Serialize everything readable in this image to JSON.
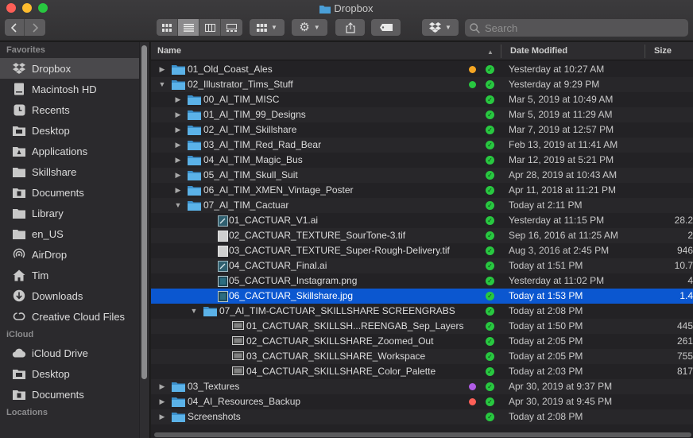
{
  "window": {
    "title": "Dropbox"
  },
  "toolbar": {
    "search_placeholder": "Search"
  },
  "sidebar": {
    "sections": [
      {
        "heading": "Favorites",
        "items": [
          {
            "label": "Dropbox",
            "icon": "dropbox-icon",
            "active": true
          },
          {
            "label": "Macintosh HD",
            "icon": "hard-drive-icon"
          },
          {
            "label": "Recents",
            "icon": "recents-icon"
          },
          {
            "label": "Desktop",
            "icon": "desktop-icon"
          },
          {
            "label": "Applications",
            "icon": "applications-icon"
          },
          {
            "label": "Skillshare",
            "icon": "folder-icon"
          },
          {
            "label": "Documents",
            "icon": "documents-icon"
          },
          {
            "label": "Library",
            "icon": "folder-icon"
          },
          {
            "label": "en_US",
            "icon": "folder-icon"
          },
          {
            "label": "AirDrop",
            "icon": "airdrop-icon"
          },
          {
            "label": "Tim",
            "icon": "home-icon"
          },
          {
            "label": "Downloads",
            "icon": "downloads-icon"
          },
          {
            "label": "Creative Cloud Files",
            "icon": "creative-cloud-icon"
          }
        ]
      },
      {
        "heading": "iCloud",
        "items": [
          {
            "label": "iCloud Drive",
            "icon": "icloud-icon"
          },
          {
            "label": "Desktop",
            "icon": "desktop-icon"
          },
          {
            "label": "Documents",
            "icon": "documents-icon"
          }
        ]
      },
      {
        "heading": "Locations",
        "items": []
      }
    ]
  },
  "columns": {
    "name": "Name",
    "date": "Date Modified",
    "size": "Size"
  },
  "files": [
    {
      "name": "01_Old_Coast_Ales",
      "kind": "folder",
      "depth": 0,
      "disclosure": "closed",
      "tag": "#f5a623",
      "date": "Yesterday at 10:27 AM",
      "size": ""
    },
    {
      "name": "02_Illustrator_Tims_Stuff",
      "kind": "folder",
      "depth": 0,
      "disclosure": "open",
      "tag": "#28c840",
      "date": "Yesterday at 9:29 PM",
      "size": ""
    },
    {
      "name": "00_AI_TIM_MISC",
      "kind": "folder",
      "depth": 1,
      "disclosure": "closed",
      "date": "Mar 5, 2019 at 10:49 AM",
      "size": ""
    },
    {
      "name": "01_AI_TIM_99_Designs",
      "kind": "folder",
      "depth": 1,
      "disclosure": "closed",
      "date": "Mar 5, 2019 at 11:29 AM",
      "size": ""
    },
    {
      "name": "02_AI_TIM_Skillshare",
      "kind": "folder",
      "depth": 1,
      "disclosure": "closed",
      "date": "Mar 7, 2019 at 12:57 PM",
      "size": ""
    },
    {
      "name": "03_AI_TIM_Red_Rad_Bear",
      "kind": "folder",
      "depth": 1,
      "disclosure": "closed",
      "date": "Feb 13, 2019 at 11:41 AM",
      "size": ""
    },
    {
      "name": "04_AI_TIM_Magic_Bus",
      "kind": "folder",
      "depth": 1,
      "disclosure": "closed",
      "date": "Mar 12, 2019 at 5:21 PM",
      "size": ""
    },
    {
      "name": "05_AI_TIM_Skull_Suit",
      "kind": "folder",
      "depth": 1,
      "disclosure": "closed",
      "date": "Apr 28, 2019 at 10:43 AM",
      "size": ""
    },
    {
      "name": "06_AI_TIM_XMEN_Vintage_Poster",
      "kind": "folder",
      "depth": 1,
      "disclosure": "closed",
      "date": "Apr 11, 2018 at 11:21 PM",
      "size": ""
    },
    {
      "name": "07_AI_TIM_Cactuar",
      "kind": "folder",
      "depth": 1,
      "disclosure": "open",
      "date": "Today at 2:11 PM",
      "size": ""
    },
    {
      "name": "01_CACTUAR_V1.ai",
      "kind": "ai",
      "depth": 2,
      "disclosure": "none",
      "date": "Yesterday at 11:15 PM",
      "size": "28.2"
    },
    {
      "name": "02_CACTUAR_TEXTURE_SourTone-3.tif",
      "kind": "tif",
      "depth": 2,
      "disclosure": "none",
      "date": "Sep 16, 2016 at 11:25 AM",
      "size": "2"
    },
    {
      "name": "03_CACTUAR_TEXTURE_Super-Rough-Delivery.tif",
      "kind": "tif",
      "depth": 2,
      "disclosure": "none",
      "date": "Aug 3, 2016 at 2:45 PM",
      "size": "946"
    },
    {
      "name": "04_CACTUAR_Final.ai",
      "kind": "ai",
      "depth": 2,
      "disclosure": "none",
      "date": "Today at 1:51 PM",
      "size": "10.7"
    },
    {
      "name": "05_CACTUAR_Instagram.png",
      "kind": "img",
      "depth": 2,
      "disclosure": "none",
      "date": "Yesterday at 11:02 PM",
      "size": "4"
    },
    {
      "name": "06_CACTUAR_Skillshare.jpg",
      "kind": "img",
      "depth": 2,
      "disclosure": "none",
      "date": "Today at 1:53 PM",
      "size": "1.4",
      "selected": true
    },
    {
      "name": "07_AI_TIM-CACTUAR_SKILLSHARE SCREENGRABS",
      "kind": "folder",
      "depth": 2,
      "disclosure": "open",
      "date": "Today at 2:08 PM",
      "size": ""
    },
    {
      "name": "01_CACTUAR_SKILLSH...REENGAB_Sep_Layers",
      "kind": "shot",
      "depth": 3,
      "disclosure": "none",
      "date": "Today at 1:50 PM",
      "size": "445"
    },
    {
      "name": "02_CACTUAR_SKILLSHARE_Zoomed_Out",
      "kind": "shot",
      "depth": 3,
      "disclosure": "none",
      "date": "Today at 2:05 PM",
      "size": "261"
    },
    {
      "name": "03_CACTUAR_SKILLSHARE_Workspace",
      "kind": "shot",
      "depth": 3,
      "disclosure": "none",
      "date": "Today at 2:05 PM",
      "size": "755"
    },
    {
      "name": "04_CACTUAR_SKILLSHARE_Color_Palette",
      "kind": "shot",
      "depth": 3,
      "disclosure": "none",
      "date": "Today at 2:03 PM",
      "size": "817"
    },
    {
      "name": "03_Textures",
      "kind": "folder",
      "depth": 0,
      "disclosure": "closed",
      "tag": "#b05ce6",
      "date": "Apr 30, 2019 at 9:37 PM",
      "size": ""
    },
    {
      "name": "04_AI_Resources_Backup",
      "kind": "folder",
      "depth": 0,
      "disclosure": "closed",
      "tag": "#fe5f57",
      "date": "Apr 30, 2019 at 9:45 PM",
      "size": ""
    },
    {
      "name": "Screenshots",
      "kind": "folder",
      "depth": 0,
      "disclosure": "closed",
      "date": "Today at 2:08 PM",
      "size": ""
    }
  ],
  "colors": {
    "selection": "#0b57d0",
    "folder": "#4a9fd8",
    "sync_ok": "#28c840"
  }
}
